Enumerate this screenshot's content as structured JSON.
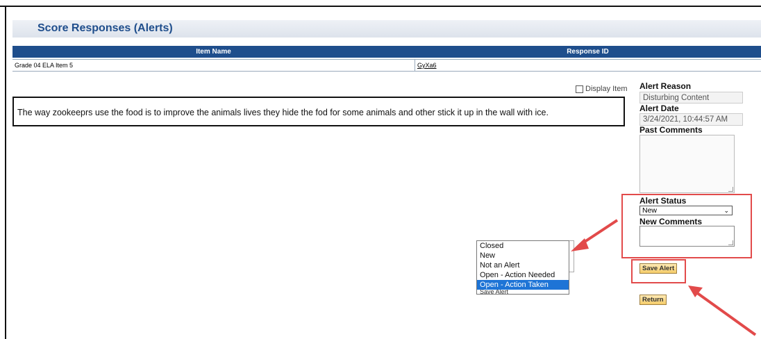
{
  "page": {
    "title": "Score Responses (Alerts)"
  },
  "grid": {
    "headers": [
      "Item Name",
      "Response ID"
    ],
    "row": {
      "item_name": "Grade 04 ELA Item 5",
      "response_id": "GyXa6"
    }
  },
  "display_item_label": "Display Item",
  "response_text": "The way zookeeprs use the food is to improve the animals lives they hide the fod for some animals and other stick it up in the wall with ice.",
  "alert_panel": {
    "alert_reason_label": "Alert Reason",
    "alert_reason_value": "Disturbing Content",
    "alert_date_label": "Alert Date",
    "alert_date_value": "3/24/2021, 10:44:57 AM",
    "past_comments_label": "Past Comments",
    "alert_status_label": "Alert Status",
    "alert_status_value": "New",
    "new_comments_label": "New Comments",
    "save_button": "Save Alert",
    "return_button": "Return"
  },
  "status_dropdown": {
    "options": [
      "Closed",
      "New",
      "Not an Alert",
      "Open - Action Needed",
      "Open - Action Taken"
    ],
    "highlighted": "Open - Action Taken",
    "cut_off_label": "Save Alert"
  },
  "colors": {
    "header_blue": "#1f4e8c",
    "annotation_red": "#e24a4a",
    "highlight": "#1e74d6"
  }
}
